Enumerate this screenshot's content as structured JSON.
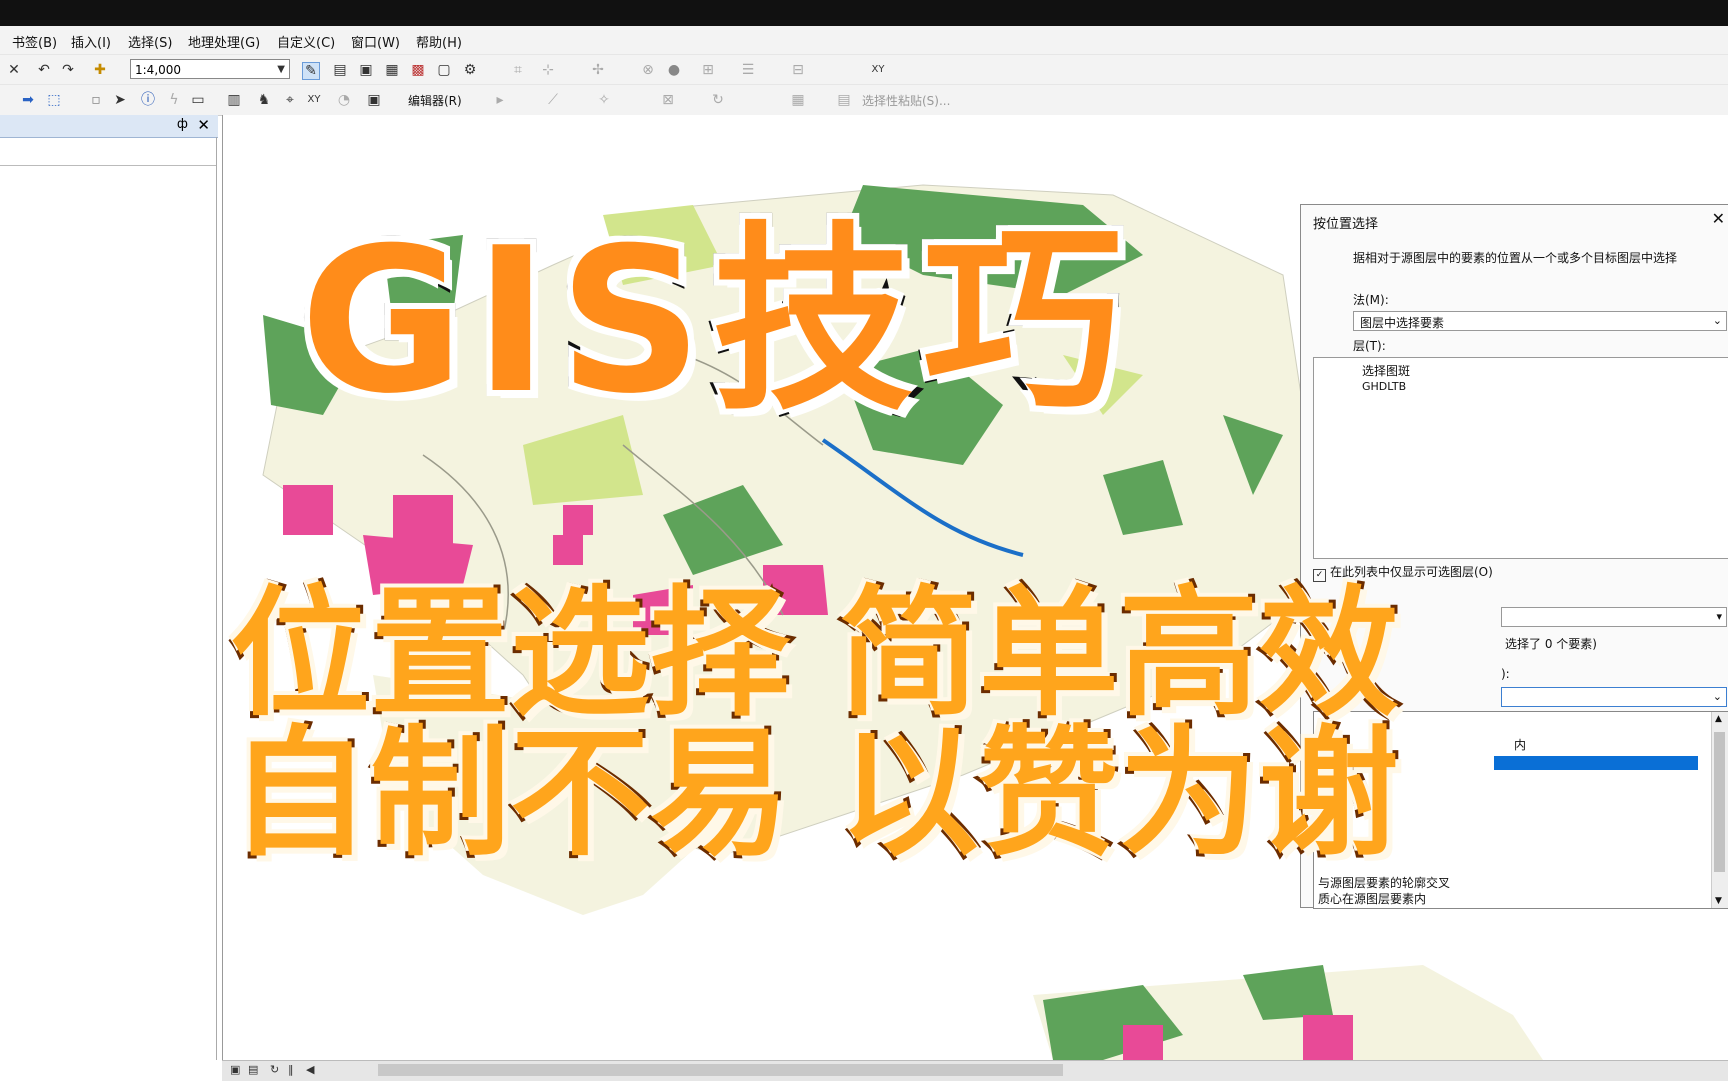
{
  "menus": [
    "书签(B)",
    "插入(I)",
    "选择(S)",
    "地理处理(G)",
    "自定义(C)",
    "窗口(W)",
    "帮助(H)"
  ],
  "toolbar": {
    "scale_value": "1:4,000",
    "editor_label": "编辑器(R)",
    "paste_label": "选择性粘贴(S)..."
  },
  "toc": {
    "pin": "ф",
    "close": "✕"
  },
  "dialog": {
    "title": "按位置选择",
    "description": "据相对于源图层中的要素的位置从一个或多个目标图层中选择",
    "method_label": "法(M):",
    "method_value": "图层中选择要素",
    "target_label": "层(T):",
    "target_layers": [
      "选择图斑",
      "GHDLTB"
    ],
    "only_selectable_label": "在此列表中仅显示可选图层(O)",
    "selected_count": "选择了 0 个要素)",
    "field_label": "):",
    "dropdown_item": "内",
    "options": [
      "与源图层要素的轮廓交叉",
      "质心在源图层要素内"
    ]
  },
  "overlay": {
    "title": "GIS技巧",
    "line1": "位置选择 简单高效",
    "line2": "自制不易 以赞为谢"
  },
  "colors": {
    "map_base": "#f4f3df",
    "green": "#5ea35a",
    "light_green": "#d2e58c",
    "pink": "#e84a97",
    "blue": "#1b6fc8",
    "highlight": "#0a6fd6"
  }
}
